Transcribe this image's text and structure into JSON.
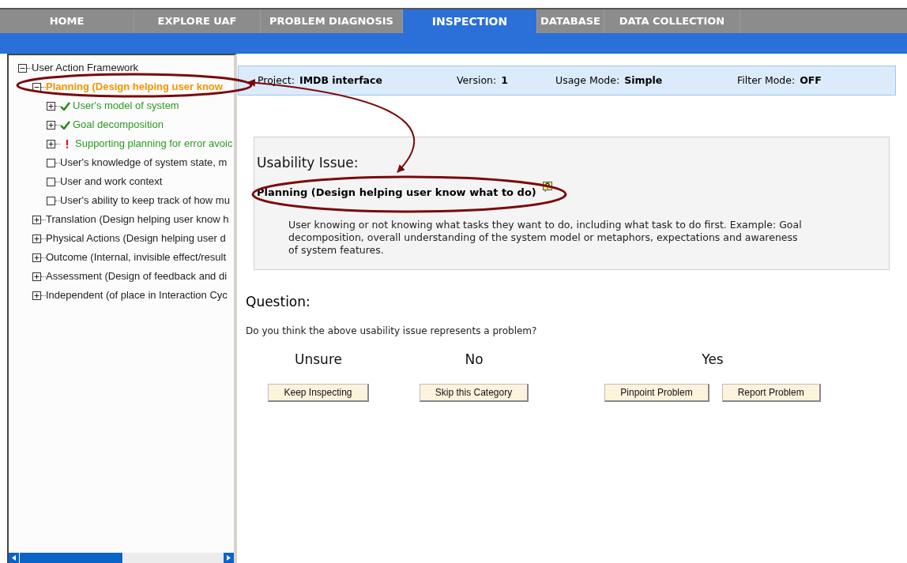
{
  "nav_tabs": [
    {
      "label": "HOME",
      "selected": false
    },
    {
      "label": "EXPLORE UAF",
      "selected": false
    },
    {
      "label": "PROBLEM DIAGNOSIS",
      "selected": false
    },
    {
      "label": "INSPECTION",
      "selected": true
    },
    {
      "label": "DATABASE",
      "selected": false
    },
    {
      "label": "DATA COLLECTION",
      "selected": false
    }
  ],
  "tree": [
    {
      "label": "User Action Framework",
      "kind": "group",
      "expanded": true,
      "selected": false,
      "children": [
        {
          "label": "Planning (Design helping user know",
          "kind": "group",
          "expanded": true,
          "selected": true,
          "children": [
            {
              "label": "User's model of system",
              "kind": "group",
              "expanded": false,
              "selected": false,
              "reviewed": true,
              "flagged": false
            },
            {
              "label": "Goal decomposition",
              "kind": "group",
              "expanded": false,
              "selected": false,
              "reviewed": true,
              "flagged": false
            },
            {
              "label": "Supporting planning for error avoic",
              "kind": "group",
              "expanded": false,
              "selected": false,
              "reviewed": false,
              "flagged": true
            },
            {
              "label": "User's knowledge of system state, m",
              "kind": "leaf",
              "selected": false,
              "reviewed": false,
              "flagged": false
            },
            {
              "label": "User and work context",
              "kind": "leaf",
              "selected": false,
              "reviewed": false,
              "flagged": false
            },
            {
              "label": "User's ability to keep track of how mu",
              "kind": "leaf",
              "selected": false,
              "reviewed": false,
              "flagged": false
            }
          ]
        },
        {
          "label": "Translation (Design helping user know h",
          "kind": "group",
          "expanded": false,
          "selected": false
        },
        {
          "label": "Physical Actions (Design helping user d",
          "kind": "group",
          "expanded": false,
          "selected": false
        },
        {
          "label": "Outcome (Internal, invisible effect/result",
          "kind": "group",
          "expanded": false,
          "selected": false
        },
        {
          "label": "Assessment (Design of feedback and di",
          "kind": "group",
          "expanded": false,
          "selected": false
        },
        {
          "label": "Independent (of place in Interaction Cyc",
          "kind": "group",
          "expanded": false,
          "selected": false
        }
      ]
    }
  ],
  "info_bar": [
    {
      "label": "Project:",
      "value": "IMDB interface"
    },
    {
      "label": "Version:",
      "value": "1"
    },
    {
      "label": "Usage Mode:",
      "value": "Simple"
    },
    {
      "label": "Filter Mode:",
      "value": "OFF"
    }
  ],
  "issue": {
    "heading": "Usability Issue:",
    "title": "Planning (Design helping user know what to do)",
    "description": "User knowing or not knowing what tasks they want to do, including what task to do first. Example: Goal decomposition, overall understanding of the system model or metaphors, expectations and awareness of system features."
  },
  "question": {
    "heading": "Question:",
    "text": "Do you think the above usability issue represents a problem?"
  },
  "answers": [
    {
      "label": "Unsure",
      "buttons": [
        "Keep Inspecting"
      ]
    },
    {
      "label": "No",
      "buttons": [
        "Skip this Category"
      ]
    },
    {
      "label": "Yes",
      "buttons": [
        "Pinpoint Problem",
        "Report Problem"
      ]
    }
  ]
}
